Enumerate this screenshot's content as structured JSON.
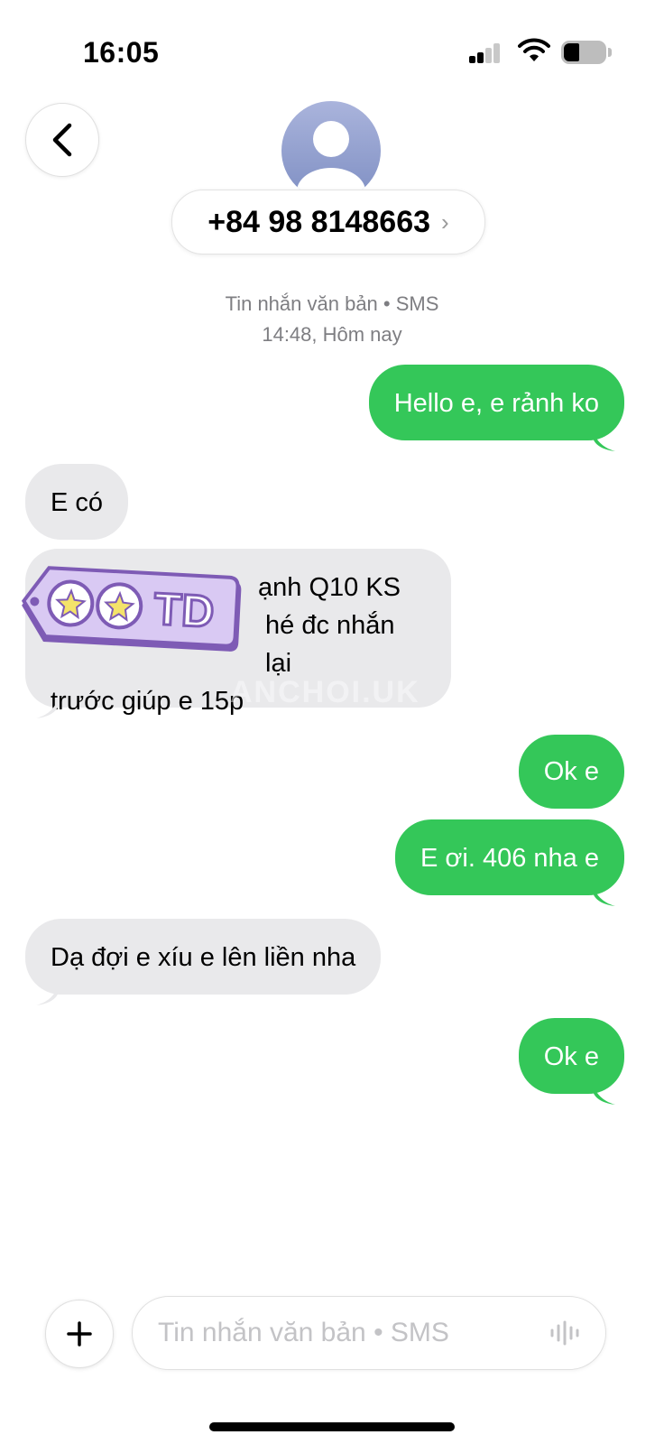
{
  "status_bar": {
    "time": "16:05"
  },
  "header": {
    "contact": "+84 98 8148663",
    "chevron": "›"
  },
  "thread_meta": {
    "line1": "Tin nhắn văn bản • SMS",
    "line2": "14:48, Hôm nay"
  },
  "messages": [
    {
      "direction": "out",
      "text": "Hello e, e rảnh ko"
    },
    {
      "direction": "in",
      "text": "E có"
    },
    {
      "direction": "in",
      "lines": [
        "ạnh Q10 KS",
        "hé đc nhắn lại",
        "trước giúp e 15p"
      ]
    },
    {
      "direction": "out",
      "text": "Ok e"
    },
    {
      "direction": "out",
      "text": "E ơi. 406 nha e"
    },
    {
      "direction": "in",
      "text": "Dạ đợi e xíu e lên liền nha"
    },
    {
      "direction": "out",
      "text": "Ok e"
    }
  ],
  "sticker": {
    "text": "TD"
  },
  "watermark": "ANCHOI.UK",
  "composer": {
    "placeholder": "Tin nhắn văn bản • SMS"
  },
  "icons": [
    "signal-icon",
    "wifi-icon",
    "battery-icon",
    "back-chevron-icon",
    "avatar-person-icon",
    "plus-icon",
    "audio-waveform-icon",
    "star-icon"
  ],
  "colors": {
    "outgoing": "#34c759",
    "incoming": "#e9e9eb",
    "meta_text": "#7e7e82"
  }
}
